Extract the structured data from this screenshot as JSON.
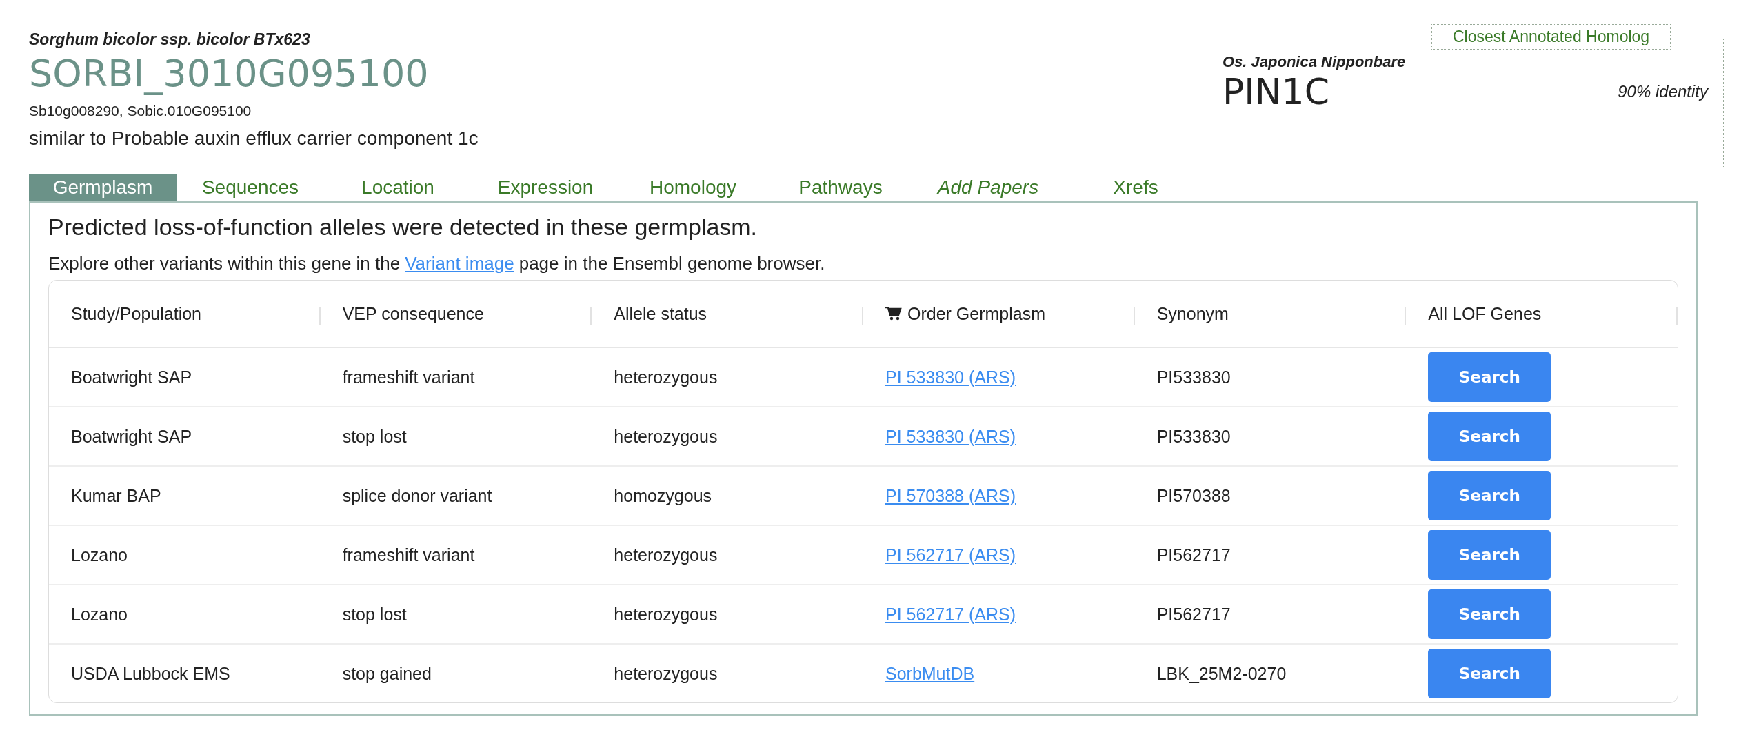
{
  "gene": {
    "species": "Sorghum bicolor ssp. bicolor BTx623",
    "id": "SORBI_3010G095100",
    "synonyms": "Sb10g008290, Sobic.010G095100",
    "description": "similar to Probable auxin efflux carrier component 1c"
  },
  "homolog": {
    "legend": "Closest Annotated Homolog",
    "species": "Os. Japonica Nipponbare",
    "name": "PIN1C",
    "identity": "90% identity"
  },
  "tabs": [
    {
      "label": "Germplasm",
      "selected": true,
      "italic": false
    },
    {
      "label": "Sequences",
      "selected": false,
      "italic": false
    },
    {
      "label": "Location",
      "selected": false,
      "italic": false
    },
    {
      "label": "Expression",
      "selected": false,
      "italic": false
    },
    {
      "label": "Homology",
      "selected": false,
      "italic": false
    },
    {
      "label": "Pathways",
      "selected": false,
      "italic": false
    },
    {
      "label": "Add Papers",
      "selected": false,
      "italic": true
    },
    {
      "label": "Xrefs",
      "selected": false,
      "italic": false
    }
  ],
  "panel": {
    "heading": "Predicted loss-of-function alleles were detected in these germplasm.",
    "explore_before": "Explore other variants within this gene in the",
    "explore_link": "Variant image",
    "explore_after": "page in the Ensembl genome browser."
  },
  "table": {
    "columns": [
      {
        "label": "Study/Population",
        "kind": "text"
      },
      {
        "label": "VEP consequence",
        "kind": "text"
      },
      {
        "label": "Allele status",
        "kind": "text"
      },
      {
        "label": "Order Germplasm",
        "kind": "cart"
      },
      {
        "label": "Synonym",
        "kind": "text"
      },
      {
        "label": "All LOF Genes",
        "kind": "text"
      }
    ],
    "rows": [
      {
        "study": "Boatwright SAP",
        "consequence": "frameshift variant",
        "status": "heterozygous",
        "order": "PI 533830 (ARS)",
        "synonym": "PI533830",
        "action": "Search"
      },
      {
        "study": "Boatwright SAP",
        "consequence": "stop lost",
        "status": "heterozygous",
        "order": "PI 533830 (ARS)",
        "synonym": "PI533830",
        "action": "Search"
      },
      {
        "study": "Kumar BAP",
        "consequence": "splice donor variant",
        "status": "homozygous",
        "order": "PI 570388 (ARS)",
        "synonym": "PI570388",
        "action": "Search"
      },
      {
        "study": "Lozano",
        "consequence": "frameshift variant",
        "status": "heterozygous",
        "order": "PI 562717 (ARS)",
        "synonym": "PI562717",
        "action": "Search"
      },
      {
        "study": "Lozano",
        "consequence": "stop lost",
        "status": "heterozygous",
        "order": "PI 562717 (ARS)",
        "synonym": "PI562717",
        "action": "Search"
      },
      {
        "study": "USDA Lubbock EMS",
        "consequence": "stop gained",
        "status": "heterozygous",
        "order": "SorbMutDB",
        "synonym": "LBK_25M2-0270",
        "action": "Search"
      }
    ]
  }
}
